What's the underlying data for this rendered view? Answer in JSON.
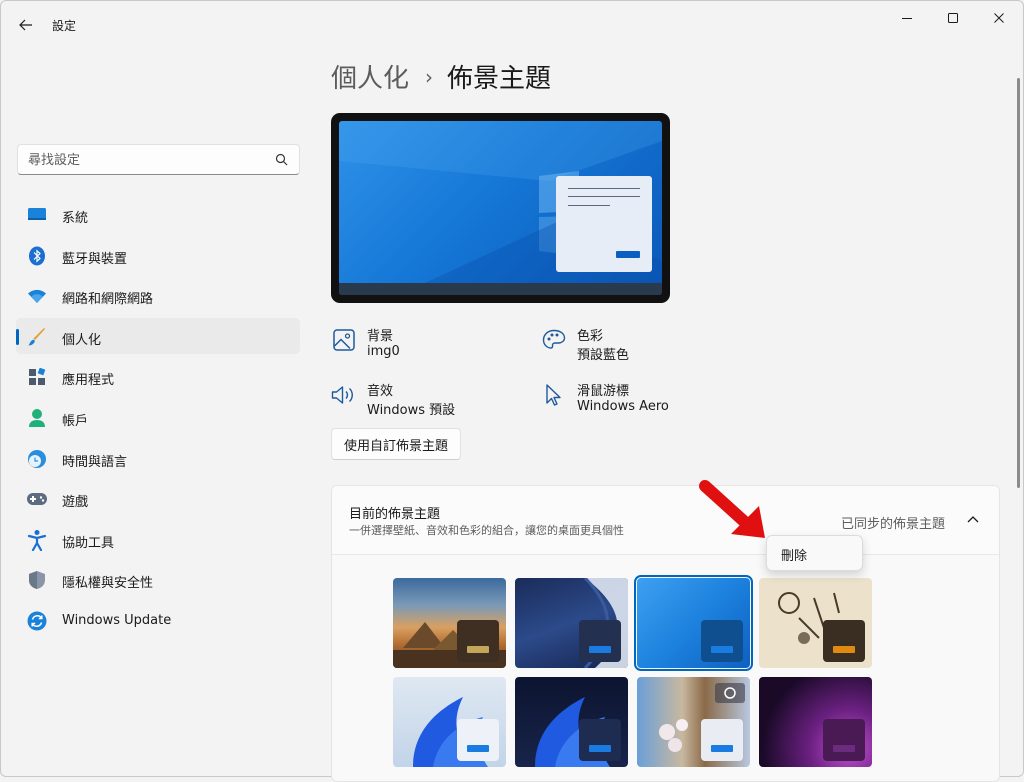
{
  "window": {
    "title": "設定",
    "controls": {
      "minimize_icon": "minimize-icon",
      "maximize_icon": "maximize-icon",
      "close_icon": "close-icon"
    }
  },
  "search": {
    "placeholder": "尋找設定",
    "value": ""
  },
  "sidebar": {
    "items": [
      {
        "label": "系統",
        "icon": "system-icon",
        "active": false
      },
      {
        "label": "藍牙與裝置",
        "icon": "bluetooth-icon",
        "active": false
      },
      {
        "label": "網路和網際網路",
        "icon": "wifi-icon",
        "active": false
      },
      {
        "label": "個人化",
        "icon": "brush-icon",
        "active": true
      },
      {
        "label": "應用程式",
        "icon": "apps-icon",
        "active": false
      },
      {
        "label": "帳戶",
        "icon": "account-icon",
        "active": false
      },
      {
        "label": "時間與語言",
        "icon": "clock-globe-icon",
        "active": false
      },
      {
        "label": "遊戲",
        "icon": "gamepad-icon",
        "active": false
      },
      {
        "label": "協助工具",
        "icon": "accessibility-icon",
        "active": false
      },
      {
        "label": "隱私權與安全性",
        "icon": "shield-icon",
        "active": false
      },
      {
        "label": "Windows Update",
        "icon": "update-icon",
        "active": false
      }
    ]
  },
  "breadcrumb": {
    "parent": "個人化",
    "separator": "›",
    "current": "佈景主題"
  },
  "options": {
    "background": {
      "title": "背景",
      "value": "img0",
      "icon": "image-icon"
    },
    "color": {
      "title": "色彩",
      "value": "預設藍色",
      "icon": "palette-icon"
    },
    "sound": {
      "title": "音效",
      "value": "Windows 預設",
      "icon": "speaker-icon"
    },
    "cursor": {
      "title": "滑鼠游標",
      "value": "Windows Aero",
      "icon": "cursor-icon"
    }
  },
  "custom_theme_button": "使用自訂佈景主題",
  "current_theme": {
    "title": "目前的佈景主題",
    "subtitle": "一併選擇壁紙、音效和色彩的組合，讓您的桌面更具個性",
    "sync_label": "已同步的佈景主題",
    "expanded": true
  },
  "theme_tiles": [
    {
      "name": "desert-pyramids",
      "swatch": "#3f2e22",
      "accent": "#c2a65a",
      "selected": false
    },
    {
      "name": "dark-blue-abstract",
      "swatch": "#23304f",
      "accent": "#1a7be0",
      "selected": false
    },
    {
      "name": "windows-blue",
      "swatch": "#0f4f8f",
      "accent": "#1a7be0",
      "selected": true
    },
    {
      "name": "sketch-art",
      "swatch": "#3a2e22",
      "accent": "#e08a10",
      "selected": false
    },
    {
      "name": "bloom-light",
      "swatch": "#eef2f8",
      "accent": "#1a7be0",
      "selected": false
    },
    {
      "name": "bloom-dark",
      "swatch": "#1e2c52",
      "accent": "#1a7be0",
      "selected": false
    },
    {
      "name": "spotlight-collection",
      "swatch": "#e9edf3",
      "accent": "#1a7be0",
      "selected": false
    },
    {
      "name": "glow",
      "swatch": "#4a1a55",
      "accent": "#6b2c80",
      "selected": false
    }
  ],
  "context_menu": {
    "items": [
      {
        "label": "刪除"
      }
    ]
  },
  "colors": {
    "accent": "#0067c0",
    "annotation_arrow": "#e01010"
  }
}
